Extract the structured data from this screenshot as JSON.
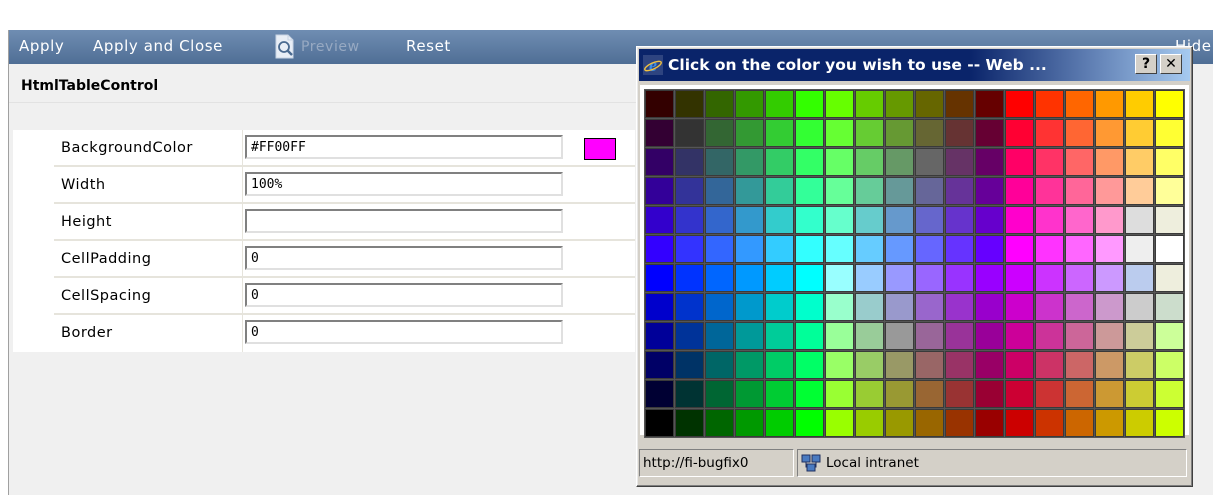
{
  "toolbar": {
    "apply": "Apply",
    "apply_close": "Apply and Close",
    "preview": "Preview",
    "reset": "Reset",
    "hide": "Hide"
  },
  "control_title": "HtmlTableControl",
  "properties": [
    {
      "label": "BackgroundColor",
      "value": "#FF00FF",
      "swatch": "#FF00FF"
    },
    {
      "label": "Width",
      "value": "100%"
    },
    {
      "label": "Height",
      "value": ""
    },
    {
      "label": "CellPadding",
      "value": "0"
    },
    {
      "label": "CellSpacing",
      "value": "0"
    },
    {
      "label": "Border",
      "value": "0"
    }
  ],
  "popup": {
    "title": "Click on the color you wish to use -- Web ...",
    "help_label": "?",
    "close_label": "✕",
    "status_url": "http://fi-bugfix0",
    "zone_label": "Local intranet",
    "icons": [
      "internet-explorer-icon",
      "local-intranet-icon"
    ]
  },
  "palette": [
    [
      "#330000",
      "#333300",
      "#336600",
      "#339900",
      "#33CC00",
      "#33FF00",
      "#66FF00",
      "#66CC00",
      "#669900",
      "#666600",
      "#663300",
      "#660000",
      "#FF0000",
      "#FF3300",
      "#FF6600",
      "#FF9900",
      "#FFCC00",
      "#FFFF00"
    ],
    [
      "#330033",
      "#333333",
      "#336633",
      "#339933",
      "#33CC33",
      "#33FF33",
      "#66FF33",
      "#66CC33",
      "#669933",
      "#666633",
      "#663333",
      "#660033",
      "#FF0033",
      "#FF3333",
      "#FF6633",
      "#FF9933",
      "#FFCC33",
      "#FFFF33"
    ],
    [
      "#330066",
      "#333366",
      "#336666",
      "#339966",
      "#33CC66",
      "#33FF66",
      "#66FF66",
      "#66CC66",
      "#669966",
      "#666666",
      "#663366",
      "#660066",
      "#FF0066",
      "#FF3366",
      "#FF6666",
      "#FF9966",
      "#FFCC66",
      "#FFFF66"
    ],
    [
      "#330099",
      "#333399",
      "#336699",
      "#339999",
      "#33CC99",
      "#33FF99",
      "#66FF99",
      "#66CC99",
      "#669999",
      "#666699",
      "#663399",
      "#660099",
      "#FF0099",
      "#FF3399",
      "#FF6699",
      "#FF9999",
      "#FFCC99",
      "#FFFF99"
    ],
    [
      "#3300CC",
      "#3333CC",
      "#3366CC",
      "#3399CC",
      "#33CCCC",
      "#33FFCC",
      "#66FFCC",
      "#66CCCC",
      "#6699CC",
      "#6666CC",
      "#6633CC",
      "#6600CC",
      "#FF00CC",
      "#FF33CC",
      "#FF66CC",
      "#FF99CC",
      "#DDDDDD",
      "#EEEEDD"
    ],
    [
      "#3300FF",
      "#3333FF",
      "#3366FF",
      "#3399FF",
      "#33CCFF",
      "#33FFFF",
      "#66FFFF",
      "#66CCFF",
      "#6699FF",
      "#6666FF",
      "#6633FF",
      "#6600FF",
      "#FF00FF",
      "#FF33FF",
      "#FF66FF",
      "#FF99FF",
      "#EEEEEE",
      "#FFFFFF"
    ],
    [
      "#0000FF",
      "#0033FF",
      "#0066FF",
      "#0099FF",
      "#00CCFF",
      "#00FFFF",
      "#99FFFF",
      "#99CCFF",
      "#9999FF",
      "#9966FF",
      "#9933FF",
      "#9900FF",
      "#CC00FF",
      "#CC33FF",
      "#CC66FF",
      "#CC99FF",
      "#BBCCEE",
      "#EEEEDD"
    ],
    [
      "#0000CC",
      "#0033CC",
      "#0066CC",
      "#0099CC",
      "#00CCCC",
      "#00FFCC",
      "#99FFCC",
      "#99CCCC",
      "#9999CC",
      "#9966CC",
      "#9933CC",
      "#9900CC",
      "#CC00CC",
      "#CC33CC",
      "#CC66CC",
      "#CC99CC",
      "#CCCCCC",
      "#CCDDCC"
    ],
    [
      "#000099",
      "#003399",
      "#006699",
      "#009999",
      "#00CC99",
      "#00FF99",
      "#99FF99",
      "#99CC99",
      "#999999",
      "#996699",
      "#993399",
      "#990099",
      "#CC0099",
      "#CC3399",
      "#CC6699",
      "#CC9999",
      "#CCCC99",
      "#CCFF99"
    ],
    [
      "#000066",
      "#003366",
      "#006666",
      "#009966",
      "#00CC66",
      "#00FF66",
      "#99FF66",
      "#99CC66",
      "#999966",
      "#996666",
      "#993366",
      "#990066",
      "#CC0066",
      "#CC3366",
      "#CC6666",
      "#CC9966",
      "#CCCC66",
      "#CCFF66"
    ],
    [
      "#000033",
      "#003333",
      "#006633",
      "#009933",
      "#00CC33",
      "#00FF33",
      "#99FF33",
      "#99CC33",
      "#999933",
      "#996633",
      "#993333",
      "#990033",
      "#CC0033",
      "#CC3333",
      "#CC6633",
      "#CC9933",
      "#CCCC33",
      "#CCFF33"
    ],
    [
      "#000000",
      "#003300",
      "#006600",
      "#009900",
      "#00CC00",
      "#00FF00",
      "#99FF00",
      "#99CC00",
      "#999900",
      "#996600",
      "#993300",
      "#990000",
      "#CC0000",
      "#CC3300",
      "#CC6600",
      "#CC9900",
      "#CCCC00",
      "#CCFF00"
    ]
  ]
}
